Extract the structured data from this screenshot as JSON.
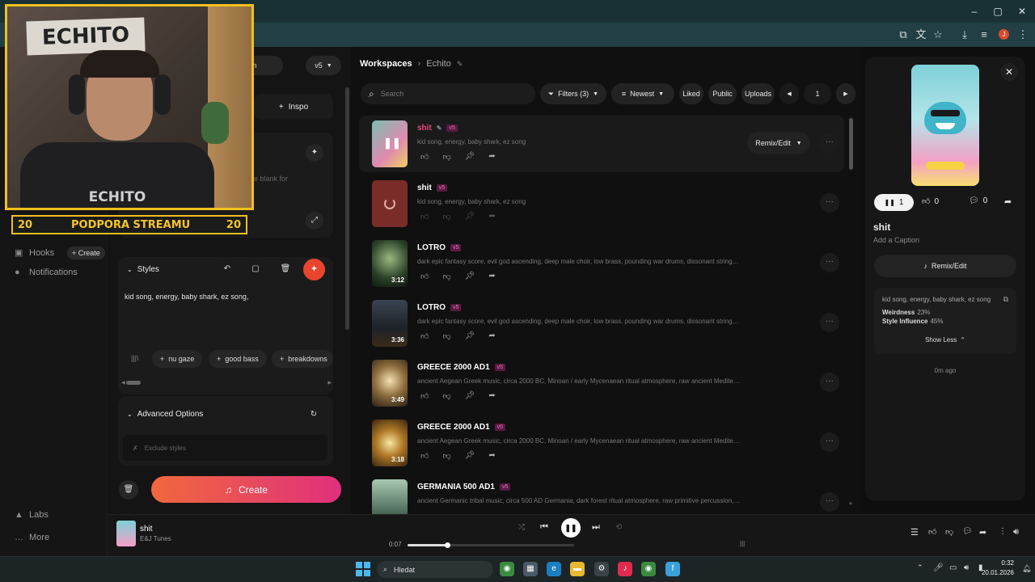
{
  "browser": {
    "window_buttons": [
      "–",
      "▢",
      "✕"
    ],
    "profile_initial": "J"
  },
  "leftnav": {
    "hooks": "Hooks",
    "create_chip": "+ Create",
    "notifications": "Notifications",
    "labs": "Labs",
    "more": "More"
  },
  "composer": {
    "mode_suffix": "m",
    "version": "v5",
    "inspo": "Inspo",
    "prompt_hint": "e blank for",
    "styles_title": "Styles",
    "styles_text": "kid song, energy, baby shark, ez song,",
    "tags": [
      "nu gaze",
      "good bass",
      "breakdowns"
    ],
    "advanced_title": "Advanced Options",
    "exclude_placeholder": "Exclude styles",
    "create_button": "Create"
  },
  "webcam": {
    "sign_text": "ECHITO",
    "shirt_text": "ECHITO",
    "banner_left": "20",
    "banner_text": "PODPORA STREAMU",
    "banner_right": "20"
  },
  "main": {
    "breadcrumb_root": "Workspaces",
    "breadcrumb_current": "Echito",
    "search_placeholder": "Search",
    "filters": "Filters (3)",
    "sort": "Newest",
    "liked": "Liked",
    "public": "Public",
    "uploads": "Uploads",
    "page": "1",
    "remix_button": "Remix/Edit",
    "songs": [
      {
        "title": "shit",
        "version": "v5",
        "desc": "kid song, energy, baby shark, ez song",
        "duration": "",
        "state": "playing"
      },
      {
        "title": "shit",
        "version": "v5",
        "desc": "kid song, energy, baby shark, ez song",
        "duration": "",
        "state": "loading"
      },
      {
        "title": "LOTRO",
        "version": "v5",
        "desc": "dark epic fantasy score, evil god ascending, deep male choir, low brass, pounding war drums, dissonant strings, ritua...",
        "duration": "3:12",
        "state": "ready"
      },
      {
        "title": "LOTRO",
        "version": "v5",
        "desc": "dark epic fantasy score, evil god ascending, deep male choir, low brass, pounding war drums, dissonant strings, ritua...",
        "duration": "3:36",
        "state": "ready"
      },
      {
        "title": "GREECE 2000 AD1",
        "version": "v5",
        "desc": "ancient Aegean Greek music, circa 2000 BC, Minoan / early Mycenaean ritual atmosphere, raw ancient Mediterran...",
        "duration": "3:49",
        "state": "ready"
      },
      {
        "title": "GREECE 2000 AD1",
        "version": "v5",
        "desc": "ancient Aegean Greek music, circa 2000 BC, Minoan / early Mycenaean ritual atmosphere, raw ancient Mediterran...",
        "duration": "3:18",
        "state": "ready"
      },
      {
        "title": "GERMANIA 500 AD1",
        "version": "v5",
        "desc": "ancient Germanic tribal music, circa 500 AD Germania, dark forest ritual atmosphere, raw primitive percussion, fram...",
        "duration": "",
        "state": "ready"
      }
    ]
  },
  "details": {
    "play_count": "1",
    "like_count": "0",
    "comment_count": "0",
    "title": "shit",
    "caption_placeholder": "Add a Caption",
    "remix_button": "Remix/Edit",
    "styles": "kid song, energy, baby shark, ez song",
    "weirdness_label": "Weirdness",
    "weirdness_value": "23%",
    "influence_label": "Style Influence",
    "influence_value": "45%",
    "show_less": "Show Less",
    "age": "0m ago"
  },
  "player": {
    "title": "shit",
    "artist": "E&J Tunes",
    "elapsed": "0:07",
    "progress": 0.24
  },
  "taskbar": {
    "search": "Hledat",
    "time": "0:32",
    "date": "20.01.2026"
  },
  "colors": {
    "accent": "#e8487a",
    "create_gradient_start": "#f0683c",
    "create_gradient_end": "#e0307c",
    "banner_gold": "#f0c020",
    "browser_toolbar": "#213f44"
  }
}
